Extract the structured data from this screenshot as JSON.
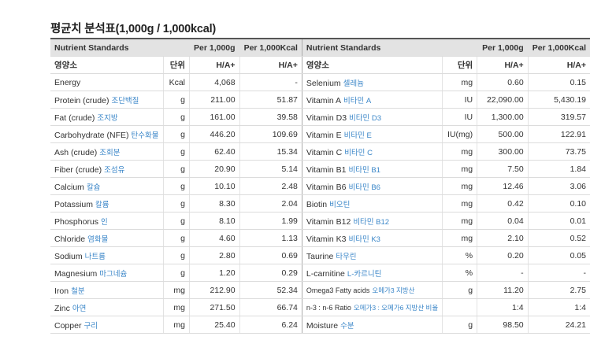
{
  "title": "평균치 분석표(1,000g / 1,000kcal)",
  "header": {
    "left_std": "Nutrient Standards",
    "left_per1000g": "Per 1,000g",
    "left_per1000kcal": "Per 1,000Kcal",
    "right_std": "Nutrient Standards",
    "right_per1000g": "Per 1,000g",
    "right_per1000kcal": "Per 1,000Kcal"
  },
  "subheader": {
    "left_name": "영양소",
    "left_unit": "단위",
    "left_g": "H/A+",
    "left_kcal": "H/A+",
    "right_name": "영양소",
    "right_unit": "단위",
    "right_g": "H/A+",
    "right_kcal": "H/A+"
  },
  "left_rows": [
    {
      "en": "Energy",
      "ko": "",
      "unit": "Kcal",
      "g": "4,068",
      "kcal": "-"
    },
    {
      "en": "Protein (crude)",
      "ko": "조단백질",
      "unit": "g",
      "g": "211.00",
      "kcal": "51.87"
    },
    {
      "en": "Fat (crude)",
      "ko": "조지방",
      "unit": "g",
      "g": "161.00",
      "kcal": "39.58"
    },
    {
      "en": "Carbohydrate (NFE)",
      "ko": "탄수화물",
      "unit": "g",
      "g": "446.20",
      "kcal": "109.69"
    },
    {
      "en": "Ash (crude)",
      "ko": "조회분",
      "unit": "g",
      "g": "62.40",
      "kcal": "15.34"
    },
    {
      "en": "Fiber (crude)",
      "ko": "조섬유",
      "unit": "g",
      "g": "20.90",
      "kcal": "5.14"
    },
    {
      "en": "Calcium",
      "ko": "칼슘",
      "unit": "g",
      "g": "10.10",
      "kcal": "2.48"
    },
    {
      "en": "Potassium",
      "ko": "칼륨",
      "unit": "g",
      "g": "8.30",
      "kcal": "2.04"
    },
    {
      "en": "Phosphorus",
      "ko": "인",
      "unit": "g",
      "g": "8.10",
      "kcal": "1.99"
    },
    {
      "en": "Chloride",
      "ko": "염화물",
      "unit": "g",
      "g": "4.60",
      "kcal": "1.13"
    },
    {
      "en": "Sodium",
      "ko": "나트륨",
      "unit": "g",
      "g": "2.80",
      "kcal": "0.69"
    },
    {
      "en": "Magnesium",
      "ko": "마그네슘",
      "unit": "g",
      "g": "1.20",
      "kcal": "0.29"
    },
    {
      "en": "Iron",
      "ko": "철분",
      "unit": "mg",
      "g": "212.90",
      "kcal": "52.34"
    },
    {
      "en": "Zinc",
      "ko": "아연",
      "unit": "mg",
      "g": "271.50",
      "kcal": "66.74"
    },
    {
      "en": "Copper",
      "ko": "구리",
      "unit": "mg",
      "g": "25.40",
      "kcal": "6.24"
    }
  ],
  "right_rows": [
    {
      "en": "Selenium",
      "ko": "셀레늄",
      "unit": "mg",
      "g": "0.60",
      "kcal": "0.15"
    },
    {
      "en": "Vitamin A",
      "ko": "비타민 A",
      "unit": "IU",
      "g": "22,090.00",
      "kcal": "5,430.19"
    },
    {
      "en": "Vitamin D3",
      "ko": "비타민 D3",
      "unit": "IU",
      "g": "1,300.00",
      "kcal": "319.57"
    },
    {
      "en": "Vitamin E",
      "ko": "비타민 E",
      "unit": "IU(mg)",
      "g": "500.00",
      "kcal": "122.91"
    },
    {
      "en": "Vitamin C",
      "ko": "비타민 C",
      "unit": "mg",
      "g": "300.00",
      "kcal": "73.75"
    },
    {
      "en": "Vitamin B1",
      "ko": "비타민 B1",
      "unit": "mg",
      "g": "7.50",
      "kcal": "1.84"
    },
    {
      "en": "Vitamin B6",
      "ko": "비타민 B6",
      "unit": "mg",
      "g": "12.46",
      "kcal": "3.06"
    },
    {
      "en": "Biotin",
      "ko": "비오틴",
      "unit": "mg",
      "g": "0.42",
      "kcal": "0.10"
    },
    {
      "en": "Vitamin B12",
      "ko": "비타민 B12",
      "unit": "mg",
      "g": "0.04",
      "kcal": "0.01"
    },
    {
      "en": "Vitamin K3",
      "ko": "비타민 K3",
      "unit": "mg",
      "g": "2.10",
      "kcal": "0.52"
    },
    {
      "en": "Taurine",
      "ko": "타우린",
      "unit": "%",
      "g": "0.20",
      "kcal": "0.05"
    },
    {
      "en": "L-carnitine",
      "ko": "L-카르니틴",
      "unit": "%",
      "g": "-",
      "kcal": "-"
    },
    {
      "en": "Omega3 Fatty acids",
      "ko": "오메가3 지방산",
      "unit": "g",
      "g": "11.20",
      "kcal": "2.75"
    },
    {
      "en": "n-3 : n-6 Ratio",
      "ko": "오메가3 : 오메가6 지방산 비율",
      "unit": "",
      "g": "1:4",
      "kcal": "1:4"
    },
    {
      "en": "Moisture",
      "ko": "수분",
      "unit": "g",
      "g": "98.50",
      "kcal": "24.21"
    }
  ]
}
